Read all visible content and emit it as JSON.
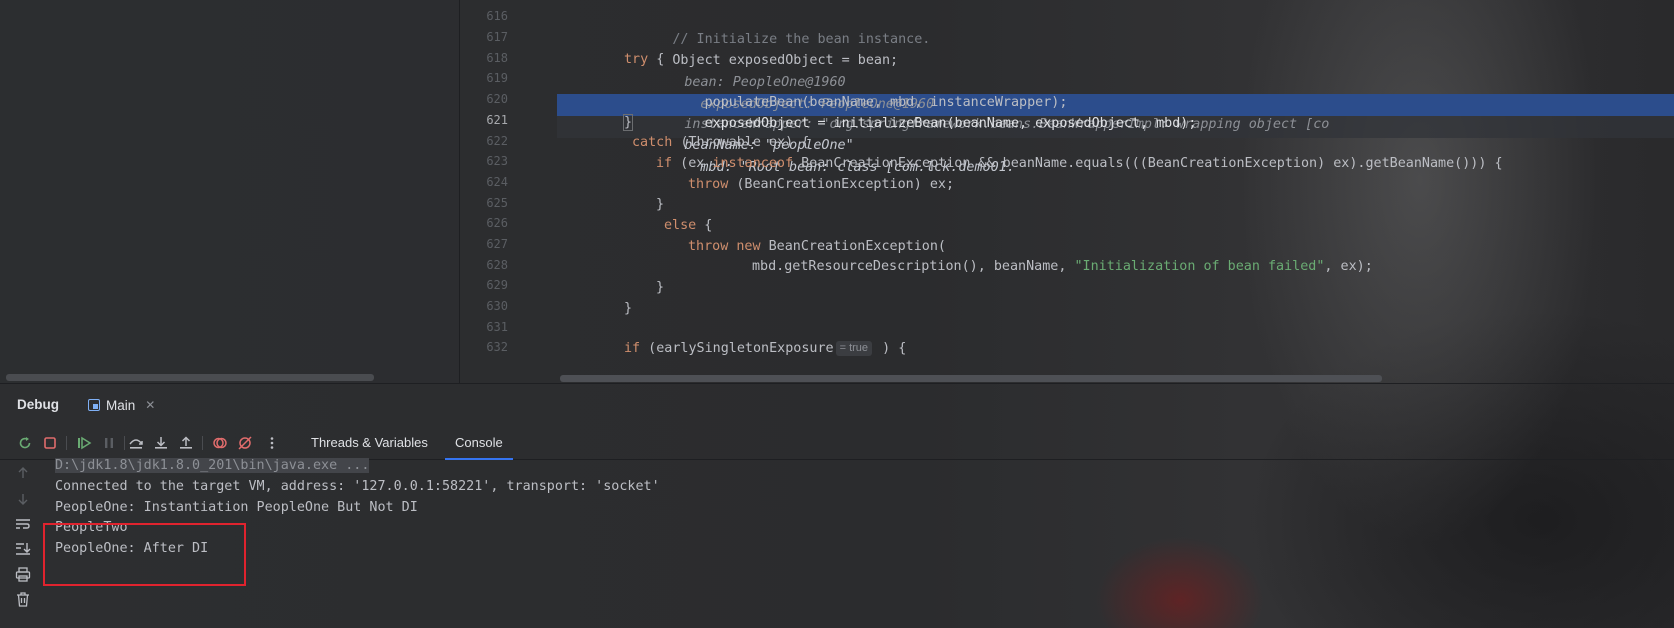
{
  "editor": {
    "line_numbers": [
      "616",
      "617",
      "618",
      "619",
      "620",
      "621",
      "622",
      "623",
      "624",
      "625",
      "626",
      "627",
      "628",
      "629",
      "630",
      "631",
      "632"
    ],
    "current_line": "621",
    "lines": {
      "l616": {
        "comment": "// Initialize the bean instance."
      },
      "l617": {
        "code": "Object exposedObject = bean;",
        "hint1": "bean: PeopleOne@1960",
        "hint2": "exposedObject: PeopleOne@1960"
      },
      "l618": {
        "kw": "try",
        "rest": " {"
      },
      "l619": {
        "code": "    populateBean(beanName, mbd, instanceWrapper);",
        "hint": "instanceWrapper: \"org.springframework.beans.BeanWrapperImpl: wrapping object [co"
      },
      "l620": {
        "code": "    exposedObject = initializeBean(beanName, exposedObject, mbd);",
        "hint1": "beanName: \"peopleOne\"",
        "hint2": "mbd: \"Root bean: class [com.lck.demo01."
      },
      "l621": {
        "code": "}"
      },
      "l622": {
        "kw": "catch",
        "rest": " (Throwable ex) {"
      },
      "l623": {
        "kw1": "if",
        "mid": " (ex ",
        "kw2": "instanceof",
        "rest": " BeanCreationException && beanName.equals(((BeanCreationException) ex).getBeanName())) {"
      },
      "l624": {
        "kw": "throw",
        "rest": " (BeanCreationException) ex;"
      },
      "l625": {
        "code": "}"
      },
      "l626": {
        "kw": "else",
        "rest": " {"
      },
      "l627": {
        "kw1": "throw",
        "kw2": "new",
        "rest": " BeanCreationException("
      },
      "l628": {
        "pre": "mbd.getResourceDescription(), beanName, ",
        "str": "\"Initialization of bean failed\"",
        "post": ", ex);"
      },
      "l629": {
        "code": "}"
      },
      "l630": {
        "code": "}"
      },
      "l631": {
        "code": ""
      },
      "l632": {
        "kw": "if",
        "pre": " (earlySingletonExposure",
        "badge": "= true",
        "post": " ) {"
      }
    }
  },
  "debug": {
    "title": "Debug",
    "session_tab": "Main",
    "toolbar": {
      "icons": [
        "rerun-icon",
        "stop-icon",
        "resume-icon",
        "pause-icon",
        "step-over-icon",
        "step-into-icon",
        "step-out-icon",
        "view-breakpoints-icon",
        "mute-breakpoints-icon",
        "more-icon"
      ]
    },
    "tabs": {
      "threads": "Threads & Variables",
      "console": "Console"
    },
    "console_lines": [
      "D:\\jdk1.8\\jdk1.8.0_201\\bin\\java.exe ...",
      "Connected to the target VM, address: '127.0.0.1:58221', transport: 'socket'",
      "PeopleOne: Instantiation PeopleOne But Not DI",
      "PeopleTwo",
      "PeopleOne: After DI"
    ],
    "side_icons": [
      "up-arrow-icon",
      "down-arrow-icon",
      "soft-wrap-icon",
      "scroll-to-end-icon",
      "print-icon",
      "clear-icon"
    ]
  },
  "colors": {
    "keyword": "#cf8e6d",
    "string": "#6aab73",
    "comment": "#7a7e85",
    "execution_line": "#2c4d8c",
    "annotation_box": "#e0232e"
  }
}
